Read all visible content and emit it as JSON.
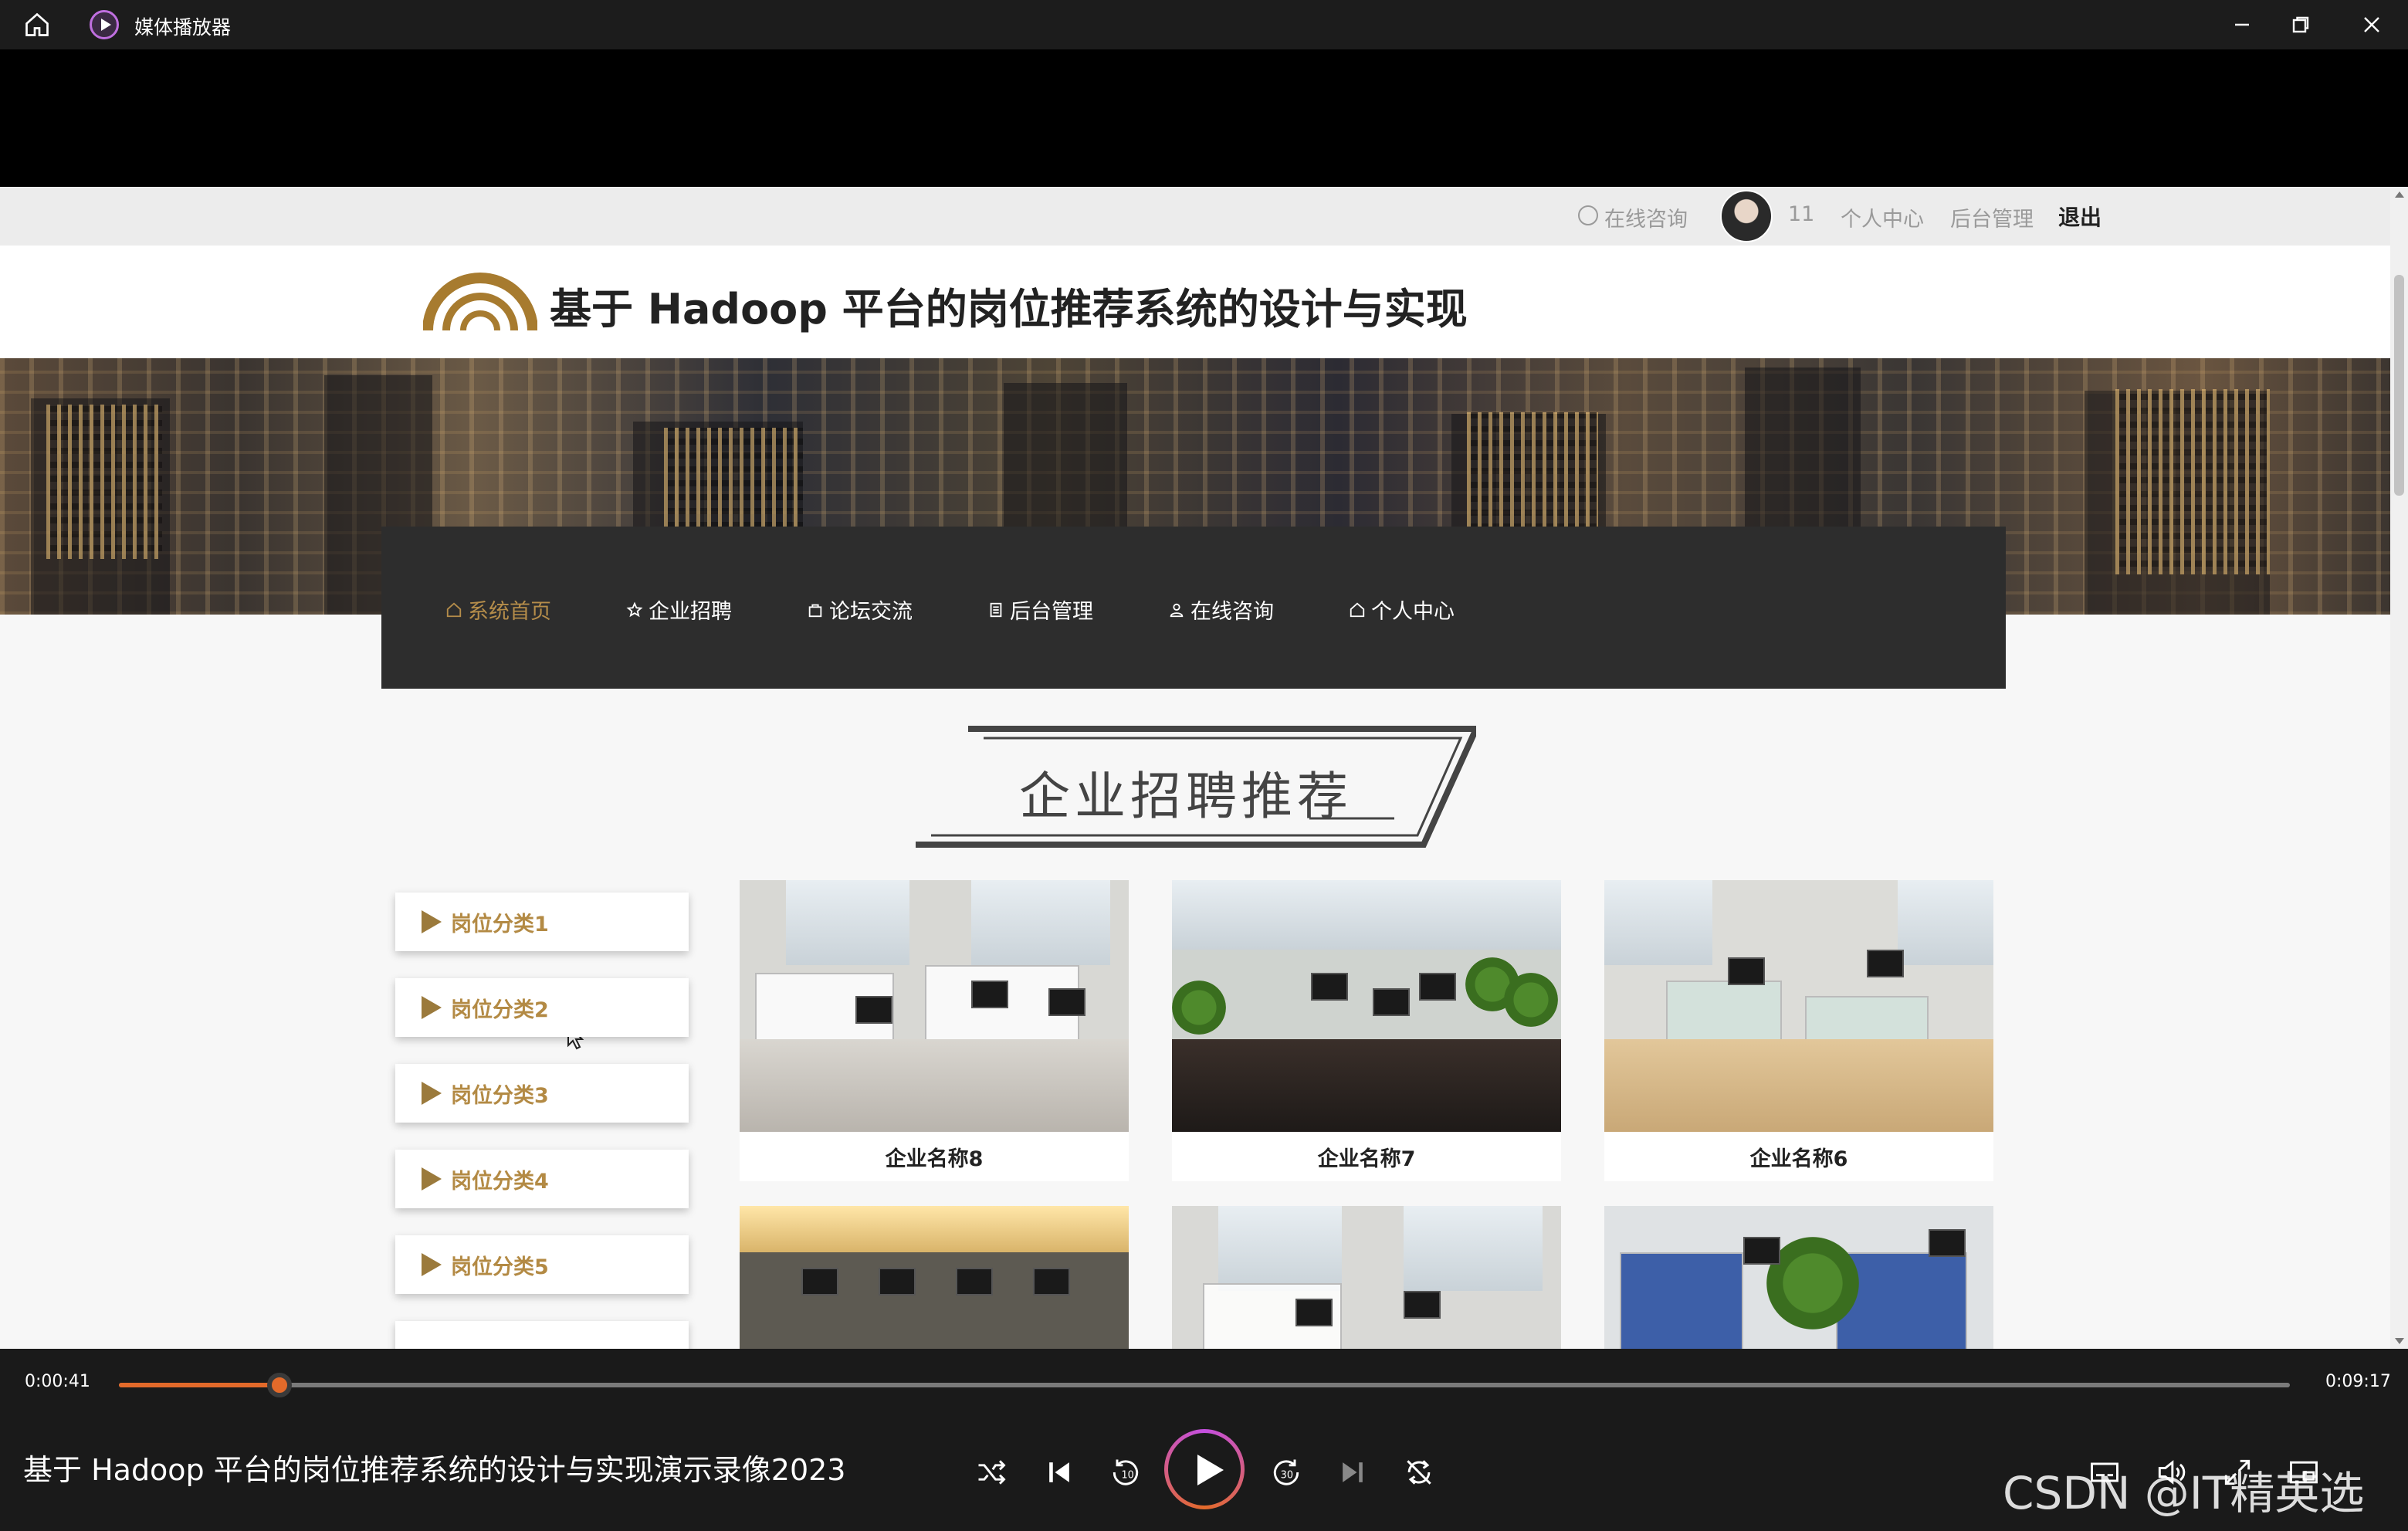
{
  "player": {
    "app_title": "媒体播放器",
    "current_time": "0:00:41",
    "total_time": "0:09:17",
    "progress_fraction": 0.074,
    "video_title": "基于 Hadoop 平台的岗位推荐系统的设计与实现演示录像2023",
    "watermark": "CSDN @IT精英选手"
  },
  "site": {
    "topbar": {
      "consult": "在线咨询",
      "username": "11",
      "personal": "个人中心",
      "admin": "后台管理",
      "logout": "退出"
    },
    "title": "基于 Hadoop 平台的岗位推荐系统的设计与实现",
    "nav": [
      {
        "label": "系统首页",
        "icon": "home-icon"
      },
      {
        "label": "企业招聘",
        "icon": "star-icon"
      },
      {
        "label": "论坛交流",
        "icon": "bag-icon"
      },
      {
        "label": "后台管理",
        "icon": "list-icon"
      },
      {
        "label": "在线咨询",
        "icon": "user-icon"
      },
      {
        "label": "个人中心",
        "icon": "home-icon"
      }
    ],
    "section_title": "企业招聘推荐",
    "categories": [
      "岗位分类1",
      "岗位分类2",
      "岗位分类3",
      "岗位分类4",
      "岗位分类5"
    ],
    "companies": [
      "企业名称8",
      "企业名称7",
      "企业名称6"
    ],
    "colors": {
      "accent": "#b38a44",
      "nav_bg": "#2d2d2d",
      "progress": "#e36a2a"
    }
  }
}
